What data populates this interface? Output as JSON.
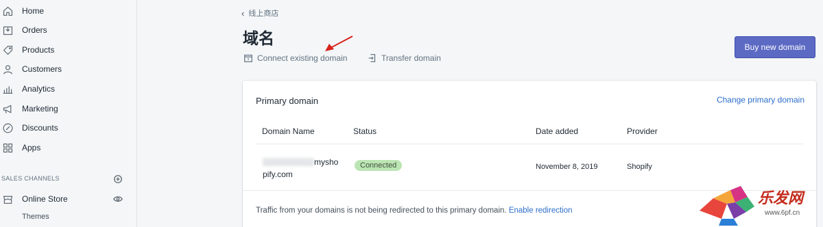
{
  "sidebar": {
    "items": [
      {
        "label": "Home",
        "icon": "home-icon"
      },
      {
        "label": "Orders",
        "icon": "orders-icon"
      },
      {
        "label": "Products",
        "icon": "tag-icon"
      },
      {
        "label": "Customers",
        "icon": "person-icon"
      },
      {
        "label": "Analytics",
        "icon": "bar-chart-icon"
      },
      {
        "label": "Marketing",
        "icon": "megaphone-icon"
      },
      {
        "label": "Discounts",
        "icon": "discount-icon"
      },
      {
        "label": "Apps",
        "icon": "apps-icon"
      }
    ],
    "sales_channels_label": "SALES CHANNELS",
    "online_store_label": "Online Store",
    "themes_label": "Themes"
  },
  "header": {
    "back_label": "线上商店",
    "title": "域名",
    "connect_label": "Connect existing domain",
    "transfer_label": "Transfer domain",
    "buy_label": "Buy new domain"
  },
  "card": {
    "title": "Primary domain",
    "change_link": "Change primary domain",
    "columns": [
      "Domain Name",
      "Status",
      "Date added",
      "Provider"
    ],
    "row": {
      "domain_part1": "mysho",
      "domain_part2": "pify.com",
      "status": "Connected",
      "date": "November 8, 2019",
      "provider": "Shopify"
    },
    "footer_text": "Traffic from your domains is not being redirected to this primary domain.",
    "footer_link": "Enable redirection"
  },
  "watermark": {
    "text": "乐发网",
    "url": "www.6pf.cn"
  },
  "colors": {
    "accent": "#5c6ac4",
    "link": "#2c6ecb",
    "badge_success": "#bbe5b3"
  }
}
